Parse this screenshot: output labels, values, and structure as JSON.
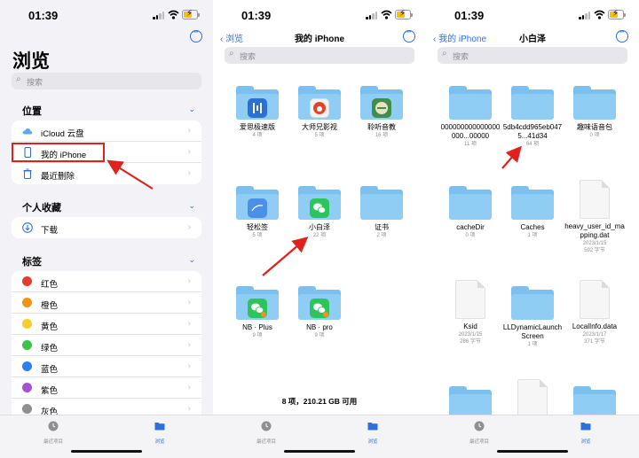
{
  "status": {
    "time": "01:39"
  },
  "colors": {
    "accent": "#2f6fe0",
    "highlight": "#e1211c",
    "folder": "#8fcdf5"
  },
  "panel1": {
    "title": "浏览",
    "search_placeholder": "搜索",
    "locations": {
      "header": "位置",
      "items": [
        {
          "label": "iCloud 云盘",
          "icon": "cloud-icon"
        },
        {
          "label": "我的 iPhone",
          "icon": "iphone-icon"
        },
        {
          "label": "最近删除",
          "icon": "trash-icon"
        }
      ]
    },
    "favorites": {
      "header": "个人收藏",
      "items": [
        {
          "label": "下载",
          "icon": "download-icon"
        }
      ]
    },
    "tags": {
      "header": "标签",
      "items": [
        {
          "label": "红色",
          "color": "#e63b30"
        },
        {
          "label": "橙色",
          "color": "#f29318"
        },
        {
          "label": "黄色",
          "color": "#f7cc2e"
        },
        {
          "label": "绿色",
          "color": "#3cc44a"
        },
        {
          "label": "蓝色",
          "color": "#2b7ff2"
        },
        {
          "label": "紫色",
          "color": "#a752d6"
        },
        {
          "label": "灰色",
          "color": "#8e8e93"
        }
      ]
    }
  },
  "panel2": {
    "back": "浏览",
    "title": "我的 iPhone",
    "search_placeholder": "搜索",
    "items": [
      {
        "name": "爱思极速版",
        "sub": "4 项",
        "app": "#2d6fd4"
      },
      {
        "name": "大师兄影视",
        "sub": "5 项",
        "app": "#f2f2f2"
      },
      {
        "name": "聆听音教",
        "sub": "16 项",
        "app": "#3f8f4a"
      },
      {
        "name": "轻松签",
        "sub": "5 项",
        "app": "#4a8fe8"
      },
      {
        "name": "小白泽",
        "sub": "22 项",
        "app": "#2ec45c"
      },
      {
        "name": "证书",
        "sub": "2 项",
        "app": ""
      },
      {
        "name": "NB · Plus",
        "sub": "9 项",
        "app": "#2ec45c"
      },
      {
        "name": "NB · pro",
        "sub": "9 项",
        "app": "#2ec45c"
      }
    ],
    "storage": "8 项，210.21 GB 可用"
  },
  "panel3": {
    "back": "我的 iPhone",
    "title": "小白泽",
    "search_placeholder": "搜索",
    "items": [
      {
        "name": "000000000000000000...00000",
        "sub": "11 项",
        "kind": "folder"
      },
      {
        "name": "5db4cdd965eb0475...41d34",
        "sub": "64 项",
        "kind": "folder"
      },
      {
        "name": "趣味语音包",
        "sub": "0 项",
        "kind": "folder"
      },
      {
        "name": "cacheDir",
        "sub": "0 项",
        "kind": "folder"
      },
      {
        "name": "Caches",
        "sub": "1 项",
        "kind": "folder"
      },
      {
        "name": "heavy_user_id_mapping.dat",
        "sub": "2023/1/15",
        "sub2": "592 字节",
        "kind": "doc"
      },
      {
        "name": "Ksid",
        "sub": "2023/1/15",
        "sub2": "286 字节",
        "kind": "doc"
      },
      {
        "name": "LLDynamicLaunchScreen",
        "sub": "1 项",
        "kind": "folder"
      },
      {
        "name": "LocalInfo.data",
        "sub": "2023/1/17",
        "sub2": "371 字节",
        "kind": "doc"
      }
    ]
  },
  "tabbar": {
    "recent": "最近项目",
    "browse": "浏览"
  }
}
